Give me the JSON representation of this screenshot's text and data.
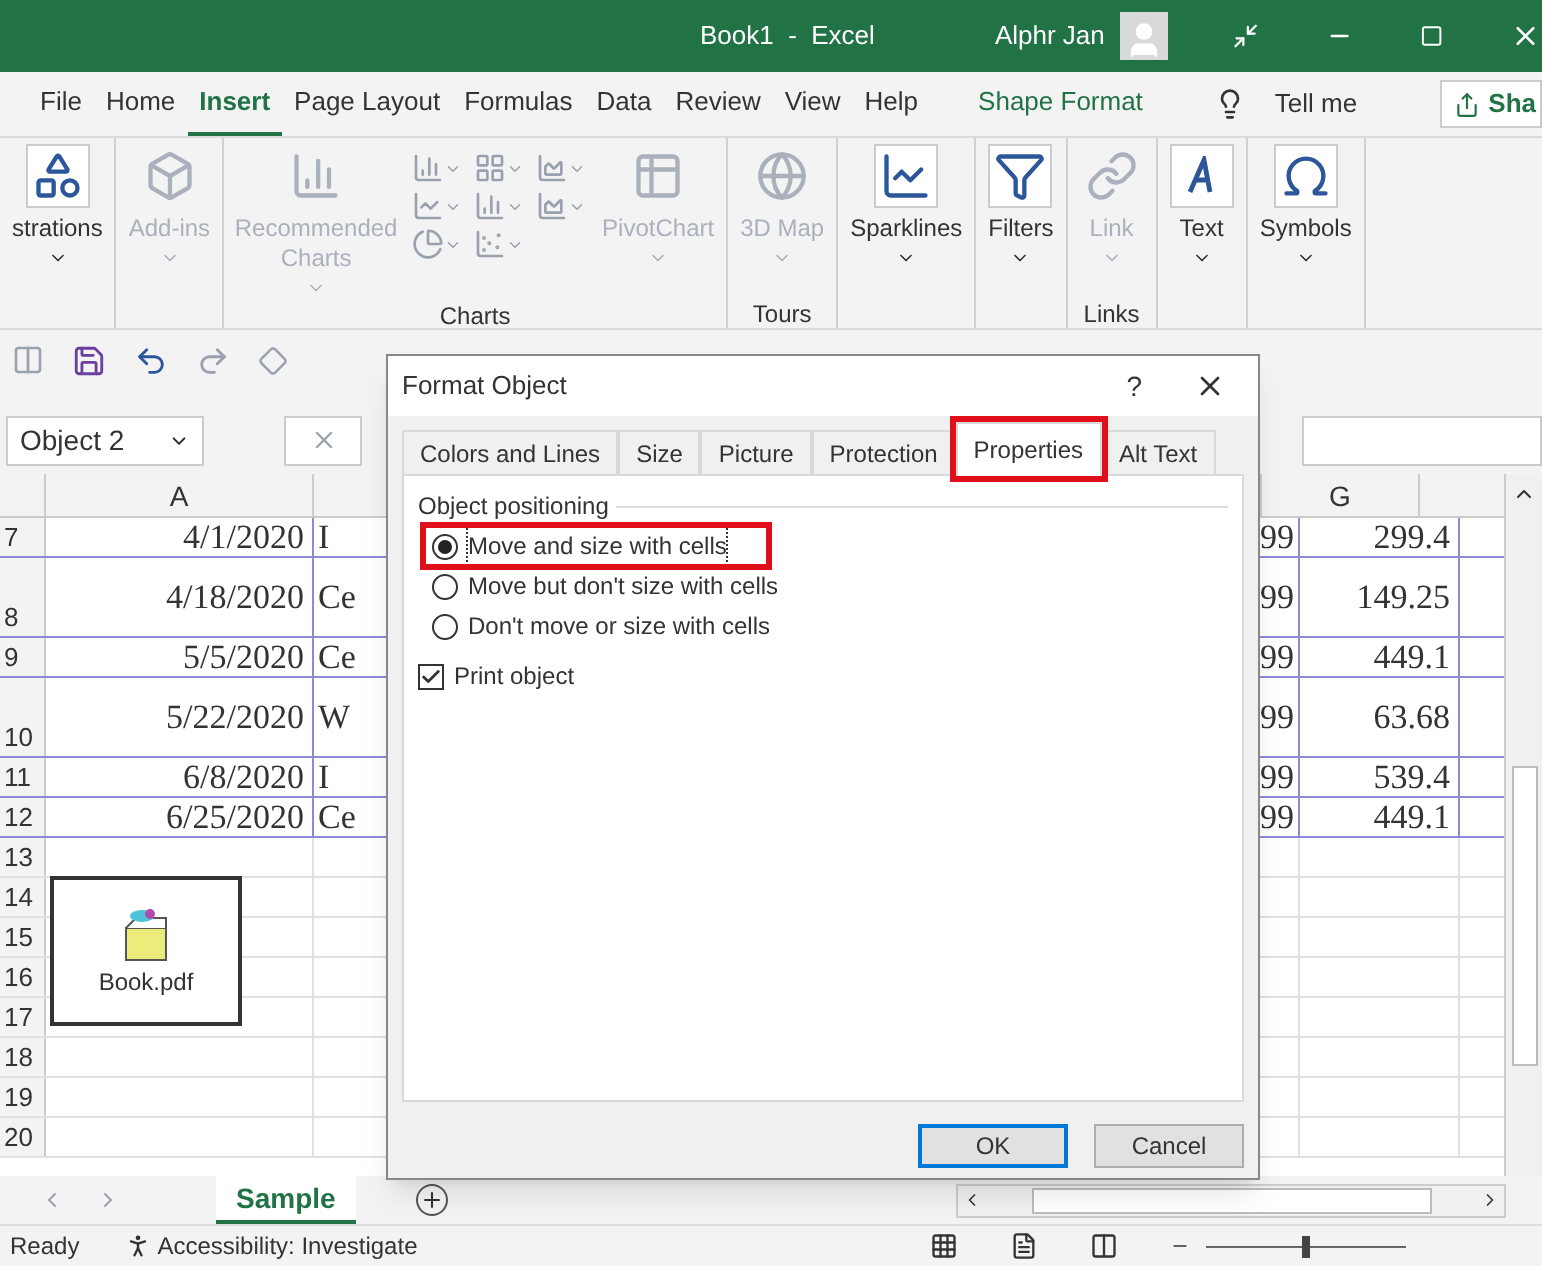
{
  "window": {
    "title": "Book1  -  Excel",
    "user": "Alphr Jan"
  },
  "menu": [
    {
      "label": "File",
      "selected": false,
      "kind": "tab"
    },
    {
      "label": "Home",
      "selected": false,
      "kind": "tab"
    },
    {
      "label": "Insert",
      "selected": true,
      "kind": "tab"
    },
    {
      "label": "Page Layout",
      "selected": false,
      "kind": "tab"
    },
    {
      "label": "Formulas",
      "selected": false,
      "kind": "tab"
    },
    {
      "label": "Data",
      "selected": false,
      "kind": "tab"
    },
    {
      "label": "Review",
      "selected": false,
      "kind": "tab"
    },
    {
      "label": "View",
      "selected": false,
      "kind": "tab"
    },
    {
      "label": "Help",
      "selected": false,
      "kind": "tab"
    },
    {
      "label": "Shape Format",
      "selected": false,
      "kind": "context"
    }
  ],
  "tell_me": "Tell me",
  "share": "Sha",
  "ribbon": [
    {
      "items": [
        {
          "label": "strations",
          "disabled": false
        }
      ]
    },
    {
      "items": [
        {
          "label": "Add-ins",
          "disabled": true
        }
      ]
    },
    {
      "label": "Charts",
      "items": [
        {
          "label": "Recommended Charts",
          "disabled": true
        },
        {
          "label": "PivotChart",
          "disabled": true
        }
      ]
    },
    {
      "label": "Tours",
      "items": [
        {
          "label": "3D Map",
          "disabled": true
        }
      ]
    },
    {
      "items": [
        {
          "label": "Sparklines",
          "disabled": false
        }
      ]
    },
    {
      "items": [
        {
          "label": "Filters",
          "disabled": false
        }
      ]
    },
    {
      "label": "Links",
      "items": [
        {
          "label": "Link",
          "disabled": true
        }
      ]
    },
    {
      "items": [
        {
          "label": "Text",
          "disabled": false
        }
      ]
    },
    {
      "items": [
        {
          "label": "Symbols",
          "disabled": false
        }
      ]
    }
  ],
  "name_box": "Object 2",
  "columns": {
    "first": "A",
    "last": "G"
  },
  "rows": [
    {
      "num": "7",
      "a": "4/1/2020",
      "b": "I",
      "f": "99",
      "g": "299.4",
      "kind": "short"
    },
    {
      "num": "8",
      "a": "4/18/2020",
      "b": "Ce",
      "f": "99",
      "g": "149.25",
      "kind": "tall"
    },
    {
      "num": "9",
      "a": "5/5/2020",
      "b": "Ce",
      "f": "99",
      "g": "449.1",
      "kind": "short"
    },
    {
      "num": "10",
      "a": "5/22/2020",
      "b": "W",
      "f": "99",
      "g": "63.68",
      "kind": "tall"
    },
    {
      "num": "11",
      "a": "6/8/2020",
      "b": "I",
      "f": "99",
      "g": "539.4",
      "kind": "short"
    },
    {
      "num": "12",
      "a": "6/25/2020",
      "b": "Ce",
      "f": "99",
      "g": "449.1",
      "kind": "short"
    }
  ],
  "empty_rows": [
    "13",
    "14",
    "15",
    "16",
    "17",
    "18",
    "19",
    "20"
  ],
  "embedded_object": {
    "label": "Book.pdf"
  },
  "dialog": {
    "title": "Format Object",
    "help": "?",
    "tabs": [
      {
        "label": "Colors and Lines",
        "selected": false,
        "highlighted": false
      },
      {
        "label": "Size",
        "selected": false,
        "highlighted": false
      },
      {
        "label": "Picture",
        "selected": false,
        "highlighted": false
      },
      {
        "label": "Protection",
        "selected": false,
        "highlighted": false
      },
      {
        "label": "Properties",
        "selected": true,
        "highlighted": true
      },
      {
        "label": "Alt Text",
        "selected": false,
        "highlighted": false
      }
    ],
    "group_label": "Object positioning",
    "options": [
      {
        "label": "Move and size with cells",
        "selected": true,
        "highlighted": true
      },
      {
        "label": "Move but don't size with cells",
        "selected": false,
        "highlighted": false
      },
      {
        "label": "Don't move or size with cells",
        "selected": false,
        "highlighted": false
      }
    ],
    "print": {
      "label": "Print object",
      "checked": true
    },
    "buttons": [
      {
        "label": "OK",
        "kind": "default"
      },
      {
        "label": "Cancel",
        "kind": "normal"
      }
    ]
  },
  "sheet_tabs": [
    {
      "label": "Sample",
      "selected": true
    }
  ],
  "status_bar": {
    "mode": "Ready",
    "accessibility": "Accessibility: Investigate",
    "zoom": {
      "level": 0.5
    }
  }
}
